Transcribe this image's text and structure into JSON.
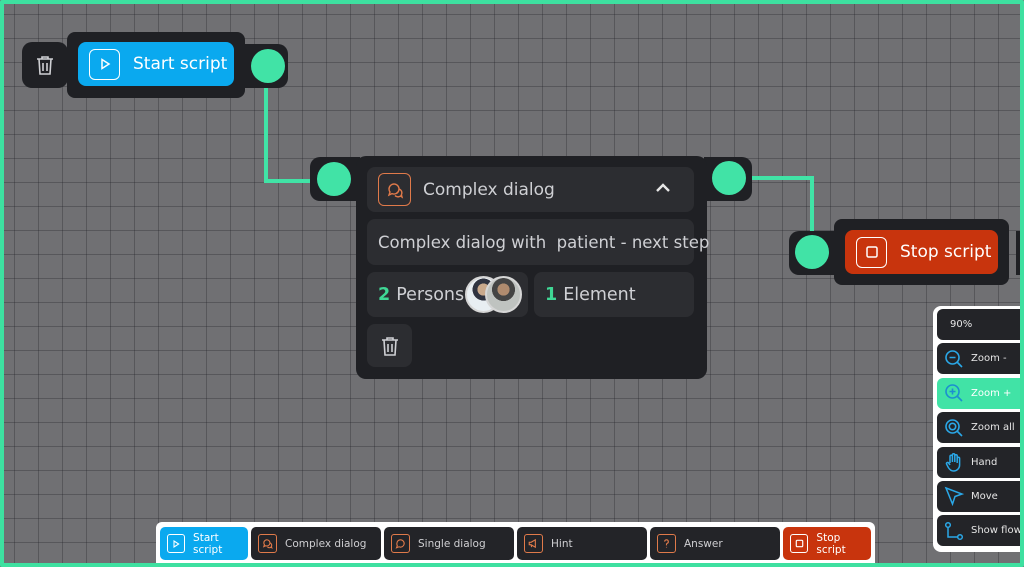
{
  "colors": {
    "accent_green": "#41e3a6",
    "start_blue": "#0aa9ef",
    "stop_red": "#c8340d",
    "dialog_orange": "#e07a4a",
    "node_dark": "#1f2024"
  },
  "nodes": {
    "start": {
      "label": "Start script",
      "icon": "play-icon"
    },
    "complex_dialog": {
      "title": "Complex dialog",
      "icon": "chat-bubbles-icon",
      "description": "Complex dialog with  patient - next step",
      "persons_count": "2",
      "persons_label": "Persons",
      "elements_count": "1",
      "elements_label": "Element"
    },
    "stop": {
      "label": "Stop script",
      "icon": "stop-square-icon"
    }
  },
  "zoom_panel": {
    "zoom_level": "90%",
    "items": [
      {
        "label": "Zoom -",
        "icon": "zoom-out-icon"
      },
      {
        "label": "Zoom +",
        "icon": "zoom-in-icon"
      },
      {
        "label": "Zoom all",
        "icon": "zoom-all-icon"
      },
      {
        "label": "Hand",
        "icon": "hand-icon"
      },
      {
        "label": "Move",
        "icon": "cursor-icon"
      },
      {
        "label": "Show flow",
        "icon": "flow-icon"
      }
    ]
  },
  "toolbar": {
    "items": [
      {
        "label": "Start script",
        "icon": "play-icon"
      },
      {
        "label": "Complex dialog",
        "icon": "chat-bubbles-icon"
      },
      {
        "label": "Single dialog",
        "icon": "chat-bubble-icon"
      },
      {
        "label": "Hint",
        "icon": "megaphone-icon"
      },
      {
        "label": "Answer",
        "icon": "question-icon"
      },
      {
        "label": "Stop script",
        "icon": "stop-square-icon"
      }
    ]
  }
}
